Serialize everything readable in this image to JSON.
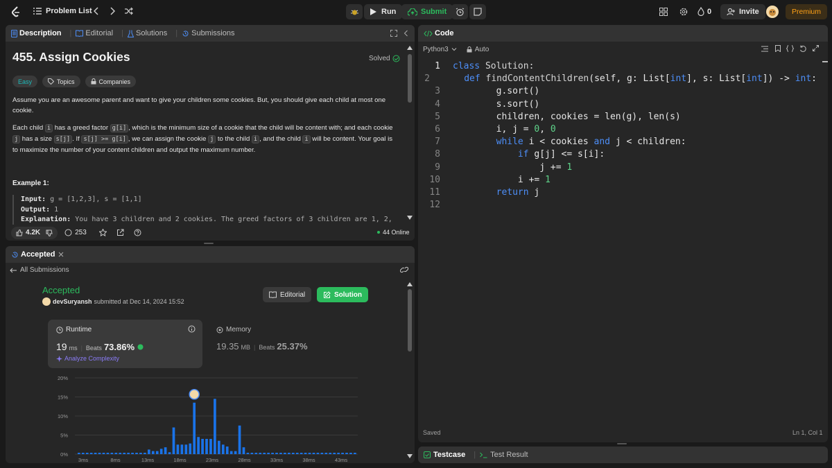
{
  "topbar": {
    "problem_list_label": "Problem List",
    "run_label": "Run",
    "submit_label": "Submit",
    "streak_count": "0",
    "invite_label": "Invite",
    "premium_label": "Premium"
  },
  "desc_panel": {
    "tabs": [
      "Description",
      "Editorial",
      "Solutions",
      "Submissions"
    ],
    "title": "455. Assign Cookies",
    "solved_label": "Solved",
    "difficulty": "Easy",
    "chips": [
      "Topics",
      "Companies"
    ],
    "p1": "Assume you are an awesome parent and want to give your children some cookies. But, you should give each child at most one cookie.",
    "p2_parts": [
      "Each child ",
      "i",
      " has a greed factor ",
      "g[i]",
      ", which is the minimum size of a cookie that the child will be content with; and each cookie ",
      "j",
      " has a size ",
      "s[j]",
      ". If ",
      "s[j] >= g[i]",
      ", we can assign the cookie ",
      "j",
      " to the child ",
      "i",
      ", and the child ",
      "i",
      " will be content. Your goal is to maximize the number of your content children and output the maximum number."
    ],
    "example_title": "Example 1:",
    "example_input_label": "Input:",
    "example_input_value": " g = [1,2,3], s = [1,1]",
    "example_output_label": "Output:",
    "example_output_value": " 1",
    "example_expl_label": "Explanation:",
    "example_expl_value": " You have 3 children and 2 cookies. The greed factors of 3 children are 1, 2,",
    "likes": "4.2K",
    "comments": "253",
    "online": "44 Online"
  },
  "submission_panel": {
    "tab": "Accepted",
    "back_label": "All Submissions",
    "status": "Accepted",
    "user": "devSuryansh",
    "submitted_text": "submitted at Dec 14, 2024 15:52",
    "editorial_btn": "Editorial",
    "solution_btn": "Solution",
    "runtime_label": "Runtime",
    "runtime_value": "19",
    "runtime_unit": "ms",
    "runtime_beats_label": "Beats",
    "runtime_beats_value": "73.86%",
    "analyze_label": "Analyze Complexity",
    "memory_label": "Memory",
    "memory_value": "19.35",
    "memory_unit": "MB",
    "memory_beats_label": "Beats",
    "memory_beats_value": "25.37%"
  },
  "chart_data": {
    "type": "bar",
    "y_ticks": [
      "20%",
      "15%",
      "10%",
      "5%",
      "0%"
    ],
    "ylim": [
      0,
      20
    ],
    "x_ticks": [
      "3ms",
      "8ms",
      "13ms",
      "18ms",
      "23ms",
      "28ms",
      "33ms",
      "38ms",
      "43ms"
    ],
    "values": [
      0.3,
      0.3,
      0.3,
      0.3,
      0.3,
      0.3,
      0.3,
      0.3,
      0.3,
      0.3,
      0.3,
      0.3,
      0.3,
      0.3,
      0.3,
      0.3,
      0.3,
      1.2,
      0.8,
      0.8,
      1.4,
      1.8,
      0.5,
      7.0,
      2.5,
      2.5,
      2.5,
      2.8,
      13.5,
      4.5,
      4.0,
      4.0,
      4.0,
      14.5,
      3.5,
      2.5,
      2.0,
      0.8,
      0.8,
      7.5,
      1.8,
      0.3,
      0.3,
      0.3,
      0.3,
      0.3,
      0.3,
      0.3,
      0.3,
      0.3,
      0.3,
      0.3,
      0.3,
      0.3,
      0.3,
      0.3,
      0.3,
      0.3,
      0.3,
      0.3,
      0.3,
      0.3,
      0.3,
      0.3,
      0.3,
      0.3,
      0.3,
      0.3
    ],
    "highlight_index": 28,
    "bar_color": "#1a73e8"
  },
  "code_panel": {
    "tab_label": "Code",
    "language": "Python3",
    "auto_label": "Auto",
    "lines": [
      [
        [
          "kw",
          "class "
        ],
        [
          "fn",
          "Solution:"
        ]
      ],
      [
        [
          "def",
          "    "
        ],
        [
          "kw",
          "def "
        ],
        [
          "fn",
          "findContentChildren"
        ],
        [
          "def",
          "(self, g: List["
        ],
        [
          "kw",
          "int"
        ],
        [
          "def",
          "], s: List["
        ],
        [
          "kw",
          "int"
        ],
        [
          "def",
          "]) -> "
        ],
        [
          "kw",
          "int"
        ],
        [
          "def",
          ":"
        ]
      ],
      [
        [
          "def",
          "        g.sort()"
        ]
      ],
      [
        [
          "def",
          "        s.sort()"
        ]
      ],
      [
        [
          "def",
          "        children, cookies = len(g), len(s)"
        ]
      ],
      [
        [
          "def",
          "        i, j = "
        ],
        [
          "num",
          "0"
        ],
        [
          "def",
          ", "
        ],
        [
          "num",
          "0"
        ]
      ],
      [
        [
          "def",
          "        "
        ],
        [
          "kw",
          "while "
        ],
        [
          "def",
          "i < cookies "
        ],
        [
          "kw",
          "and "
        ],
        [
          "def",
          "j < children:"
        ]
      ],
      [
        [
          "def",
          "            "
        ],
        [
          "kw",
          "if "
        ],
        [
          "def",
          "g[j] <= s[i]:"
        ]
      ],
      [
        [
          "def",
          "                j += "
        ],
        [
          "num",
          "1"
        ]
      ],
      [
        [
          "def",
          "            i += "
        ],
        [
          "num",
          "1"
        ]
      ],
      [
        [
          "def",
          "        "
        ],
        [
          "kw",
          "return "
        ],
        [
          "def",
          "j"
        ]
      ],
      [
        [
          "def",
          ""
        ]
      ]
    ],
    "saved_label": "Saved",
    "cursor_pos": "Ln 1, Col 1"
  },
  "test_panel": {
    "testcase_label": "Testcase",
    "result_label": "Test Result"
  }
}
